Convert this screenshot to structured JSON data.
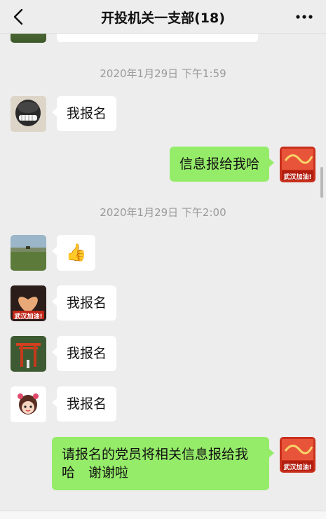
{
  "header": {
    "title": "开投机关一支部(18)",
    "back_icon": "chevron-left-icon",
    "more_icon": "more-dots-icon"
  },
  "timestamps": [
    "2020年1月29日 下午1:59",
    "2020年1月29日 下午2:00"
  ],
  "messages": [
    {
      "side": "left",
      "avatar": "helmet-face-avatar",
      "text": "我报名"
    },
    {
      "side": "right",
      "avatar": "wuhan-jiayou-avatar",
      "text": "信息报给我哈"
    },
    {
      "side": "left",
      "avatar": "landscape-avatar",
      "emoji": "👍"
    },
    {
      "side": "left",
      "avatar": "heart-sunset-avatar",
      "text": "我报名"
    },
    {
      "side": "left",
      "avatar": "torii-gate-avatar",
      "text": "我报名"
    },
    {
      "side": "left",
      "avatar": "cartoon-girl-avatar",
      "text": "我报名"
    },
    {
      "side": "right",
      "avatar": "wuhan-jiayou-avatar",
      "text": "请报名的党员将相关信息报给我哈　谢谢啦"
    }
  ],
  "avatar_badge": {
    "wuhan_text": "武汉加油!"
  },
  "colors": {
    "self_bubble": "#95ec69",
    "other_bubble": "#ffffff",
    "background": "#ededed"
  }
}
